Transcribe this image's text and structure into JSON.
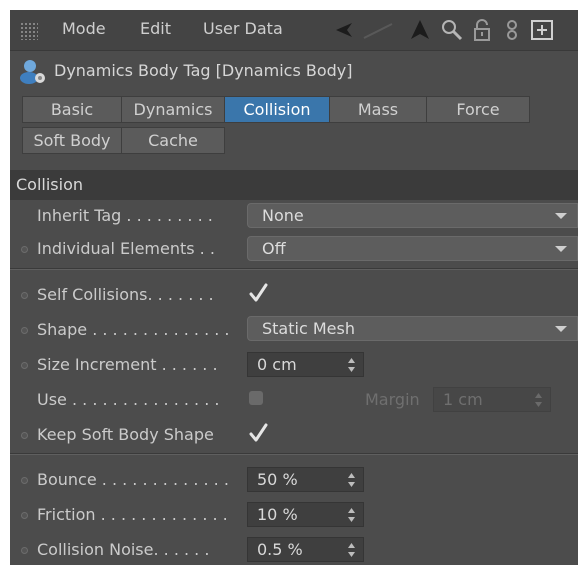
{
  "menubar": {
    "items": [
      "Mode",
      "Edit",
      "User Data"
    ],
    "icons": [
      "back-arrow-icon",
      "pointer-arrow-icon",
      "search-icon",
      "lock-icon",
      "link-icon",
      "new-window-icon"
    ]
  },
  "title": {
    "text": "Dynamics Body Tag [Dynamics Body]",
    "icon": "dynamics-body-icon"
  },
  "tabs": [
    {
      "label": "Basic",
      "active": false
    },
    {
      "label": "Dynamics",
      "active": false
    },
    {
      "label": "Collision",
      "active": true
    },
    {
      "label": "Mass",
      "active": false
    },
    {
      "label": "Force",
      "active": false
    },
    {
      "label": "Soft Body",
      "active": false
    },
    {
      "label": "Cache",
      "active": false
    }
  ],
  "section": {
    "title": "Collision"
  },
  "fields": {
    "inherit_tag": {
      "label": "Inherit Tag . . . . . . . . .",
      "value": "None"
    },
    "individual_elements": {
      "label": "Individual Elements . .",
      "value": "Off"
    },
    "self_collisions": {
      "label": "Self Collisions. . . . . . .",
      "checked": true
    },
    "shape": {
      "label": "Shape . . . . . . . . . . . . . .",
      "value": "Static Mesh"
    },
    "size_increment": {
      "label": "Size Increment . . . . . .",
      "value": "0 cm"
    },
    "use": {
      "label": "Use . . . . . . . . . . . . . . .",
      "checked": false
    },
    "margin": {
      "label": "Margin",
      "value": "1 cm"
    },
    "keep_soft_body_shape": {
      "label": "Keep Soft Body Shape",
      "checked": true
    },
    "bounce": {
      "label": "Bounce . . . . . . . . . . . . .",
      "value": "50 %"
    },
    "friction": {
      "label": "Friction . . . . . . . . . . . . .",
      "value": "10 %"
    },
    "collision_noise": {
      "label": "Collision Noise. . . . . .",
      "value": "0.5 %"
    }
  },
  "colors": {
    "panel": "#4c4c4c",
    "active_tab": "#3a76ab",
    "section_header": "#3b3b3b"
  }
}
